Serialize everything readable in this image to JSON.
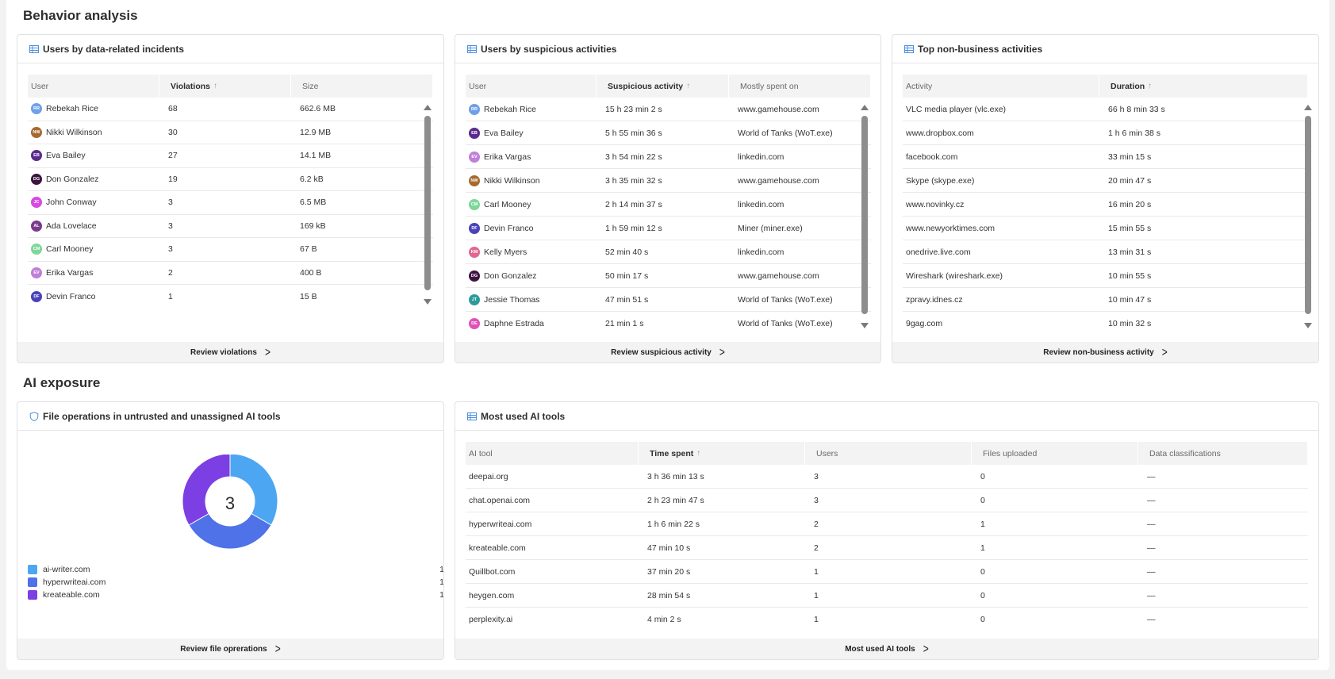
{
  "behavior": {
    "title": "Behavior analysis",
    "incidents": {
      "title": "Users by data-related incidents",
      "columns": [
        "User",
        "Violations",
        "Size"
      ],
      "sort_arrow": "↑",
      "rows": [
        {
          "initials": "RR",
          "color": "#6fa0e8",
          "user": "Rebekah Rice",
          "violations": "68",
          "size": "662.6 MB"
        },
        {
          "initials": "NW",
          "color": "#a5692f",
          "user": "Nikki Wilkinson",
          "violations": "30",
          "size": "12.9 MB"
        },
        {
          "initials": "EB",
          "color": "#5a2b8c",
          "user": "Eva Bailey",
          "violations": "27",
          "size": "14.1 MB"
        },
        {
          "initials": "DG",
          "color": "#3d1440",
          "user": "Don Gonzalez",
          "violations": "19",
          "size": "6.2 kB"
        },
        {
          "initials": "JC",
          "color": "#d84adf",
          "user": "John Conway",
          "violations": "3",
          "size": "6.5 MB"
        },
        {
          "initials": "AL",
          "color": "#7a3a8c",
          "user": "Ada Lovelace",
          "violations": "3",
          "size": "169 kB"
        },
        {
          "initials": "CM",
          "color": "#7fd69a",
          "user": "Carl Mooney",
          "violations": "3",
          "size": "67 B"
        },
        {
          "initials": "EV",
          "color": "#c07fd8",
          "user": "Erika Vargas",
          "violations": "2",
          "size": "400 B"
        },
        {
          "initials": "DF",
          "color": "#4a43b8",
          "user": "Devin Franco",
          "violations": "1",
          "size": "15 B"
        }
      ],
      "footer": "Review violations"
    },
    "suspicious": {
      "title": "Users by suspicious activities",
      "columns": [
        "User",
        "Suspicious activity",
        "Mostly spent on"
      ],
      "sort_arrow": "↑",
      "rows": [
        {
          "initials": "RR",
          "color": "#6fa0e8",
          "user": "Rebekah Rice",
          "activity": "15 h 23 min 2 s",
          "spent": "www.gamehouse.com"
        },
        {
          "initials": "EB",
          "color": "#5a2b8c",
          "user": "Eva Bailey",
          "activity": "5 h 55 min 36 s",
          "spent": "World of Tanks (WoT.exe)"
        },
        {
          "initials": "EV",
          "color": "#c07fd8",
          "user": "Erika Vargas",
          "activity": "3 h 54 min 22 s",
          "spent": "linkedin.com"
        },
        {
          "initials": "NW",
          "color": "#a5692f",
          "user": "Nikki Wilkinson",
          "activity": "3 h 35 min 32 s",
          "spent": "www.gamehouse.com"
        },
        {
          "initials": "CM",
          "color": "#7fd69a",
          "user": "Carl Mooney",
          "activity": "2 h 14 min 37 s",
          "spent": "linkedin.com"
        },
        {
          "initials": "DF",
          "color": "#4a43b8",
          "user": "Devin Franco",
          "activity": "1 h 59 min 12 s",
          "spent": "Miner (miner.exe)"
        },
        {
          "initials": "KM",
          "color": "#e0678f",
          "user": "Kelly Myers",
          "activity": "52 min 40 s",
          "spent": "linkedin.com"
        },
        {
          "initials": "DG",
          "color": "#3d1440",
          "user": "Don Gonzalez",
          "activity": "50 min 17 s",
          "spent": "www.gamehouse.com"
        },
        {
          "initials": "JT",
          "color": "#2e9a9a",
          "user": "Jessie Thomas",
          "activity": "47 min 51 s",
          "spent": "World of Tanks (WoT.exe)"
        },
        {
          "initials": "DE",
          "color": "#e051b8",
          "user": "Daphne Estrada",
          "activity": "21 min 1 s",
          "spent": "World of Tanks (WoT.exe)"
        }
      ],
      "footer": "Review suspicious activity"
    },
    "nonbusiness": {
      "title": "Top non-business activities",
      "columns": [
        "Activity",
        "Duration"
      ],
      "sort_arrow": "↑",
      "rows": [
        {
          "activity": "VLC media player (vlc.exe)",
          "duration": "66 h 8 min 33 s"
        },
        {
          "activity": "www.dropbox.com",
          "duration": "1 h 6 min 38 s"
        },
        {
          "activity": "facebook.com",
          "duration": "33 min 15 s"
        },
        {
          "activity": "Skype (skype.exe)",
          "duration": "20 min 47 s"
        },
        {
          "activity": "www.novinky.cz",
          "duration": "16 min 20 s"
        },
        {
          "activity": "www.newyorktimes.com",
          "duration": "15 min 55 s"
        },
        {
          "activity": "onedrive.live.com",
          "duration": "13 min 31 s"
        },
        {
          "activity": "Wireshark (wireshark.exe)",
          "duration": "10 min 55 s"
        },
        {
          "activity": "zpravy.idnes.cz",
          "duration": "10 min 47 s"
        },
        {
          "activity": "9gag.com",
          "duration": "10 min 32 s"
        }
      ],
      "footer": "Review non-business activity"
    }
  },
  "ai": {
    "title": "AI exposure",
    "fileops": {
      "title": "File operations in untrusted and unassigned AI tools",
      "total": "3",
      "footer": "Review file oprerations"
    },
    "tools": {
      "title": "Most used AI tools",
      "columns": [
        "AI tool",
        "Time spent",
        "Users",
        "Files uploaded",
        "Data classifications"
      ],
      "sort_arrow": "↑",
      "rows": [
        {
          "tool": "deepai.org",
          "time": "3 h 36 min 13 s",
          "users": "3",
          "files": "0",
          "classes": "—"
        },
        {
          "tool": "chat.openai.com",
          "time": "2 h 23 min 47 s",
          "users": "3",
          "files": "0",
          "classes": "—"
        },
        {
          "tool": "hyperwriteai.com",
          "time": "1 h 6 min 22 s",
          "users": "2",
          "files": "1",
          "classes": "—"
        },
        {
          "tool": "kreateable.com",
          "time": "47 min 10 s",
          "users": "2",
          "files": "1",
          "classes": "—"
        },
        {
          "tool": "Quillbot.com",
          "time": "37 min 20 s",
          "users": "1",
          "files": "0",
          "classes": "—"
        },
        {
          "tool": "heygen.com",
          "time": "28 min 54 s",
          "users": "1",
          "files": "0",
          "classes": "—"
        },
        {
          "tool": "perplexity.ai",
          "time": "4 min 2 s",
          "users": "1",
          "files": "0",
          "classes": "—"
        }
      ],
      "footer": "Most used AI tools"
    }
  },
  "chart_data": {
    "type": "pie",
    "donut": true,
    "categories": [
      "ai-writer.com",
      "hyperwriteai.com",
      "kreateable.com"
    ],
    "values": [
      1,
      1,
      1
    ],
    "colors": [
      "#4da6f2",
      "#4f72e8",
      "#7b3fe4"
    ],
    "center_label": "3",
    "legend_position": "bottom-left"
  }
}
